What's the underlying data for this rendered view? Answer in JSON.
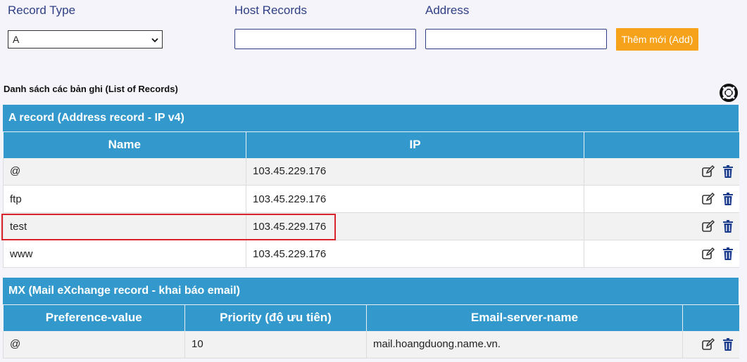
{
  "form": {
    "record_type_label": "Record Type",
    "record_type_value": "A",
    "host_records_label": "Host Records",
    "host_records_value": "",
    "address_label": "Address",
    "address_value": "",
    "add_button": "Thêm mới (Add)"
  },
  "list_title": "Danh sách các bản ghi (List of Records)",
  "a_record": {
    "title": "A record (Address record - IP v4)",
    "columns": [
      "Name",
      "IP",
      ""
    ],
    "rows": [
      {
        "name": "@",
        "ip": "103.45.229.176"
      },
      {
        "name": "ftp",
        "ip": "103.45.229.176"
      },
      {
        "name": "test",
        "ip": "103.45.229.176"
      },
      {
        "name": "www",
        "ip": "103.45.229.176"
      }
    ]
  },
  "mx_record": {
    "title": "MX (Mail eXchange record - khai báo email)",
    "columns": [
      "Preference-value",
      "Priority (độ ưu tiên)",
      "Email-server-name",
      ""
    ],
    "rows": [
      {
        "preference": "@",
        "priority": "10",
        "server": "mail.hoangduong.name.vn."
      }
    ]
  },
  "icons": {
    "help": "lifebuoy-icon",
    "edit": "edit-icon",
    "delete": "trash-icon"
  },
  "colors": {
    "header_blue": "#3399cc",
    "add_orange": "#f7a21b",
    "label_navy": "#2f3f86",
    "delete_navy": "#1a3a8c",
    "highlight_red": "#d9232d"
  }
}
